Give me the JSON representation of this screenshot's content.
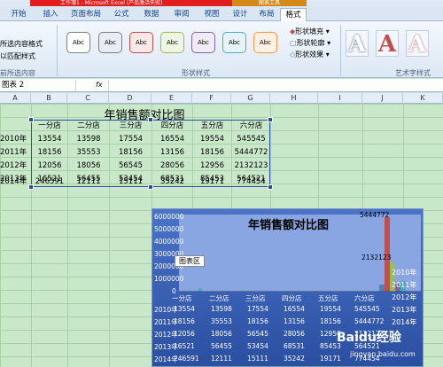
{
  "titlebar": {
    "text": "工作簿1 - Microsoft Excel (产品激活失败)",
    "context": "图表工具"
  },
  "tabs": [
    "开始",
    "插入",
    "页面布局",
    "公式",
    "数据",
    "审阅",
    "视图",
    "设计",
    "布局",
    "格式"
  ],
  "ribbon": {
    "left_items": [
      "所选内容格式",
      "以匹配样式",
      "前所选内容"
    ],
    "shape_styles_label": "形状样式",
    "shape_style_abc": [
      "Abc",
      "Abc",
      "Abc",
      "Abc",
      "Abc",
      "Abc",
      "Abc"
    ],
    "shape_fill": "形状填充",
    "shape_outline": "形状轮廓",
    "shape_effect": "形状效果",
    "art_styles_label": "艺术字样式",
    "art_letter": "A"
  },
  "formula_bar": {
    "name_box": "图表 2",
    "fx": "fx"
  },
  "columns": [
    "A",
    "B",
    "C",
    "D",
    "E",
    "F",
    "G",
    "H",
    "I",
    "J",
    "K"
  ],
  "table": {
    "title": "年销售额对比图",
    "headers": [
      "一分店",
      "二分店",
      "三分店",
      "四分店",
      "五分店",
      "六分店"
    ],
    "rows": [
      {
        "year": "2010年",
        "values": [
          "13554",
          "13598",
          "17554",
          "16554",
          "19554",
          "545545"
        ]
      },
      {
        "year": "2011年",
        "values": [
          "18156",
          "35553",
          "18156",
          "13156",
          "18156",
          "5444772"
        ]
      },
      {
        "year": "2012年",
        "values": [
          "12056",
          "18056",
          "56545",
          "28056",
          "12956",
          "2132123"
        ]
      },
      {
        "year": "2013年",
        "values": [
          "16521",
          "56455",
          "53454",
          "68531",
          "85453",
          "564521"
        ]
      },
      {
        "year": "2014年",
        "values": [
          "246591",
          "12111",
          "15111",
          "35242",
          "19171",
          "774454"
        ]
      }
    ]
  },
  "chart": {
    "title": "年销售额对比图",
    "tooltip": "图表区",
    "y_ticks": [
      "6000000",
      "5000000",
      "4000000",
      "3000000",
      "2000000",
      "1000000",
      "0"
    ],
    "peak_label": "5444772",
    "peak2_label": "2132123",
    "legend": [
      "2010年",
      "2011年",
      "2012年",
      "2013年",
      "2014年"
    ],
    "series_colors": {
      "s2010": "#4f81bd",
      "s2011": "#c0504d",
      "s2012": "#9bbb59",
      "s2013": "#8064a2",
      "s2014": "#4bacc6"
    },
    "table_headers": [
      "一分店",
      "二分店",
      "三分店",
      "四分店",
      "五分店",
      "六分店"
    ],
    "table_years": [
      "2010年",
      "2011年",
      "2012年",
      "2013年",
      "2014年"
    ],
    "table_values": [
      [
        "13554",
        "13598",
        "17554",
        "16554",
        "19554",
        "545545"
      ],
      [
        "18156",
        "35553",
        "18156",
        "13156",
        "18156",
        "5444772"
      ],
      [
        "12056",
        "18056",
        "56545",
        "28056",
        "12956",
        "2132123"
      ],
      [
        "16521",
        "56455",
        "53454",
        "68531",
        "85453",
        "564521"
      ],
      [
        "246591",
        "12111",
        "15111",
        "35242",
        "19171",
        "774454"
      ]
    ]
  },
  "watermark": {
    "text": "Baidu经验",
    "url": "jingyan.baidu.com"
  }
}
